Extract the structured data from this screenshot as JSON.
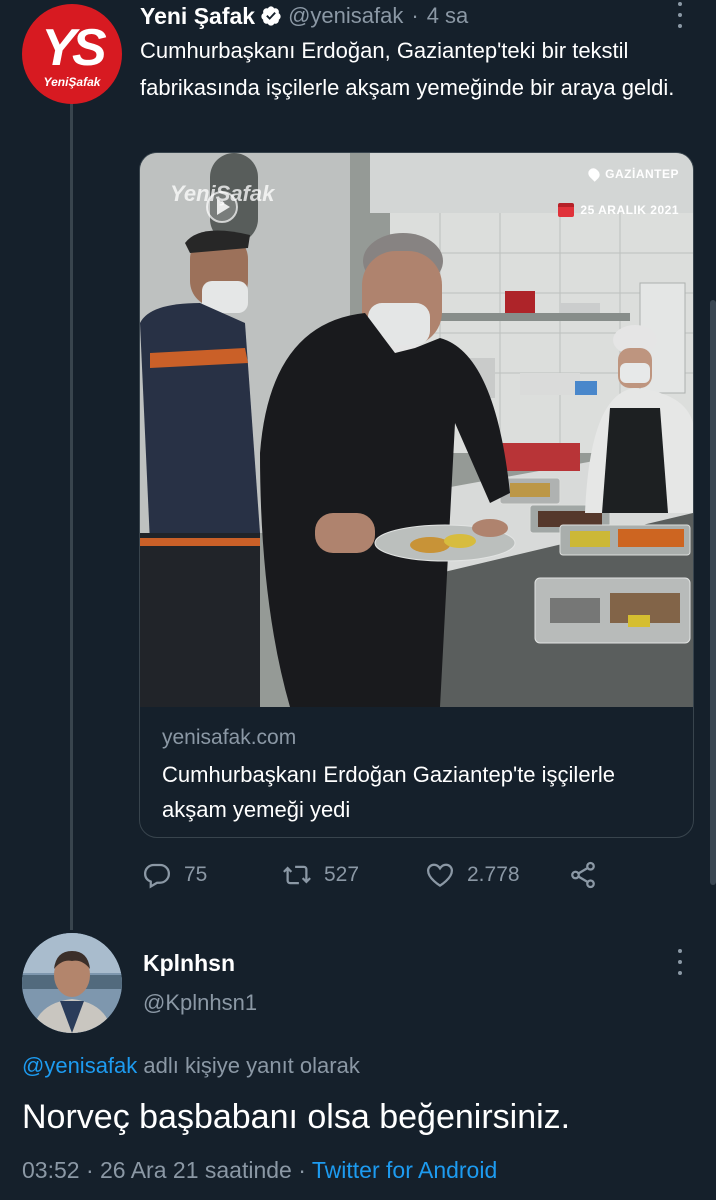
{
  "tweet": {
    "author_name": "Yeni Şafak",
    "handle": "@yenisafak",
    "separator": "·",
    "time": "4 sa",
    "avatar_text": "YS",
    "avatar_subtext": "YeniŞafak",
    "text": "Cumhurbaşkanı Erdoğan, Gaziantep'teki bir tekstil fabrikasında işçilerle akşam yemeğinde bir araya geldi.",
    "card": {
      "watermark": "YeniŞafak",
      "location_badge": "GAZİANTEP",
      "date_badge": "25 ARALIK 2021",
      "domain": "yenisafak.com",
      "title": "Cumhurbaşkanı Erdoğan Gaziantep'te işçilerle akşam yemeği yedi"
    },
    "actions": {
      "replies": "75",
      "retweets": "527",
      "likes": "2.778"
    }
  },
  "reply": {
    "author_name": "Kplnhsn",
    "handle": "@Kplnhsn1",
    "reply_prefix_mention": "@yenisafak",
    "reply_prefix_text": " adlı kişiye yanıt olarak",
    "text": "Norveç başbabanı olsa beğenirsiniz.",
    "time": "03:52",
    "date": "26 Ara 21 saatinde",
    "separator": "·",
    "client": "Twitter for Android"
  },
  "colors": {
    "background": "#15202b",
    "accent": "#1d9bf0",
    "secondary_text": "#8b98a5",
    "brand_red": "#d71a21"
  }
}
